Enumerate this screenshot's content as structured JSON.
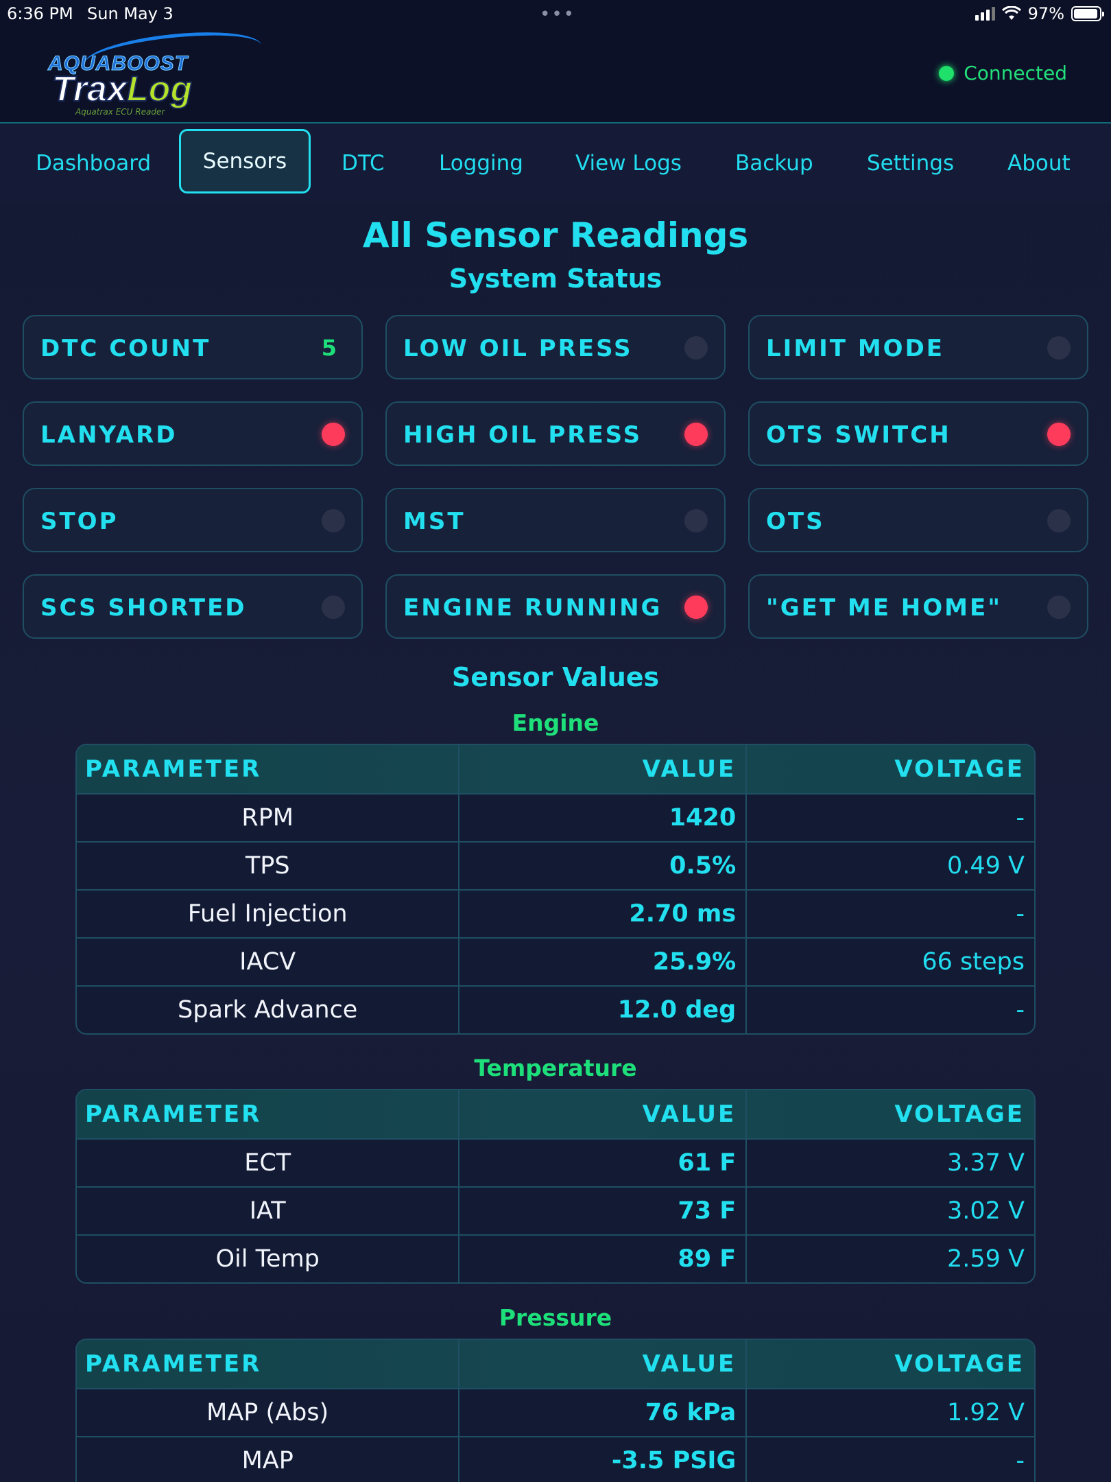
{
  "status_bar": {
    "time": "6:36 PM",
    "date": "Sun May 3",
    "battery": "97%",
    "dots": "•••"
  },
  "header": {
    "logo_top": "AQUABOOST",
    "logo_main": "Trax",
    "logo_main2": "Log",
    "logo_sub": "Aquatrax ECU Reader",
    "connection": "Connected"
  },
  "nav": [
    "Dashboard",
    "Sensors",
    "DTC",
    "Logging",
    "View Logs",
    "Backup",
    "Settings",
    "About"
  ],
  "nav_active": "Sensors",
  "page_title": "All Sensor Readings",
  "system_status_title": "System Status",
  "status_cards": [
    {
      "label": "DTC COUNT",
      "value": "5"
    },
    {
      "label": "LOW OIL PRESS",
      "on": false
    },
    {
      "label": "LIMIT MODE",
      "on": false
    },
    {
      "label": "LANYARD",
      "on": true
    },
    {
      "label": "HIGH OIL PRESS",
      "on": true
    },
    {
      "label": "OTS SWITCH",
      "on": true
    },
    {
      "label": "STOP",
      "on": false
    },
    {
      "label": "MST",
      "on": false
    },
    {
      "label": "OTS",
      "on": false
    },
    {
      "label": "SCS SHORTED",
      "on": false
    },
    {
      "label": "ENGINE RUNNING",
      "on": true
    },
    {
      "label": "\"GET ME HOME\"",
      "on": false
    }
  ],
  "sensor_values_title": "Sensor Values",
  "table_headers": {
    "parameter": "PARAMETER",
    "value": "VALUE",
    "voltage": "VOLTAGE"
  },
  "sections": [
    {
      "title": "Engine",
      "rows": [
        {
          "param": "RPM",
          "value": "1420",
          "voltage": "-"
        },
        {
          "param": "TPS",
          "value": "0.5%",
          "voltage": "0.49 V"
        },
        {
          "param": "Fuel Injection",
          "value": "2.70 ms",
          "voltage": "-"
        },
        {
          "param": "IACV",
          "value": "25.9%",
          "voltage": "66 steps"
        },
        {
          "param": "Spark Advance",
          "value": "12.0 deg",
          "voltage": "-"
        }
      ]
    },
    {
      "title": "Temperature",
      "rows": [
        {
          "param": "ECT",
          "value": "61 F",
          "voltage": "3.37 V"
        },
        {
          "param": "IAT",
          "value": "73 F",
          "voltage": "3.02 V"
        },
        {
          "param": "Oil Temp",
          "value": "89 F",
          "voltage": "2.59 V"
        }
      ]
    },
    {
      "title": "Pressure",
      "rows": [
        {
          "param": "MAP (Abs)",
          "value": "76 kPa",
          "voltage": "1.92 V"
        },
        {
          "param": "MAP",
          "value": "-3.5 PSIG",
          "voltage": "-"
        }
      ]
    }
  ]
}
